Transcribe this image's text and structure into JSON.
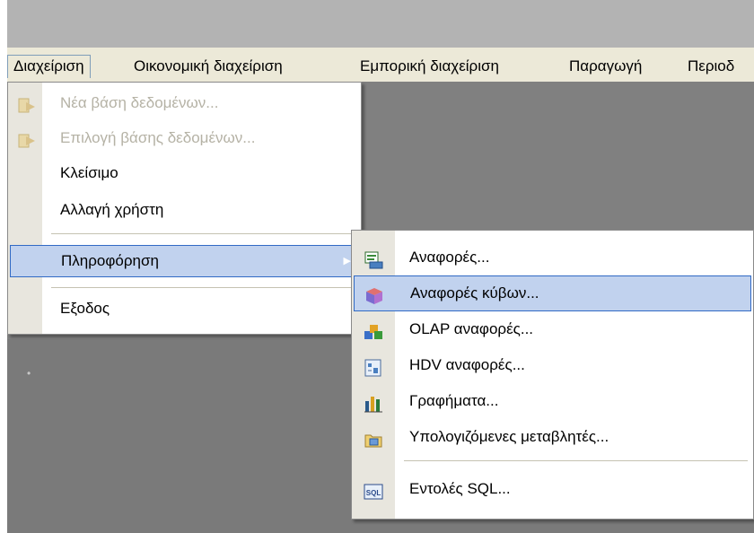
{
  "menubar": {
    "items": [
      {
        "label": "Διαχείριση"
      },
      {
        "label": "Οικονομική διαχείριση"
      },
      {
        "label": "Εμπορική διαχείριση"
      },
      {
        "label": "Παραγωγή"
      },
      {
        "label": "Περιοδ"
      }
    ]
  },
  "dropdown": {
    "items": [
      {
        "label": "Νέα βάση δεδομένων...",
        "state": "disabled",
        "icon": "new-database-icon"
      },
      {
        "label": "Επιλογή βάσης δεδομένων...",
        "state": "disabled",
        "icon": "select-database-icon"
      },
      {
        "label": "Κλείσιμο",
        "state": "enabled"
      },
      {
        "label": "Αλλαγή χρήστη",
        "state": "enabled"
      },
      {
        "label": "Πληροφόρηση",
        "state": "highlighted",
        "submenu_arrow": "▶"
      },
      {
        "label": "Εξοδος",
        "state": "enabled"
      }
    ]
  },
  "submenu": {
    "items": [
      {
        "label": "Αναφορές...",
        "icon": "reports-icon"
      },
      {
        "label": "Αναφορές κύβων...",
        "icon": "cube-reports-icon",
        "state": "highlighted"
      },
      {
        "label": "OLAP αναφορές...",
        "icon": "olap-icon"
      },
      {
        "label": "HDV αναφορές...",
        "icon": "hdv-icon"
      },
      {
        "label": "Γραφήματα...",
        "icon": "charts-icon"
      },
      {
        "label": "Υπολογιζόμενες μεταβλητές...",
        "icon": "calc-vars-icon"
      },
      {
        "label": "Εντολές SQL...",
        "icon": "sql-icon",
        "icon_text": "SQL"
      }
    ]
  },
  "colors": {
    "highlight_bg": "#c1d2ee",
    "highlight_border": "#316ac5",
    "disabled_text": "#b5b2a5",
    "menubar_bg": "#ece9d8"
  }
}
